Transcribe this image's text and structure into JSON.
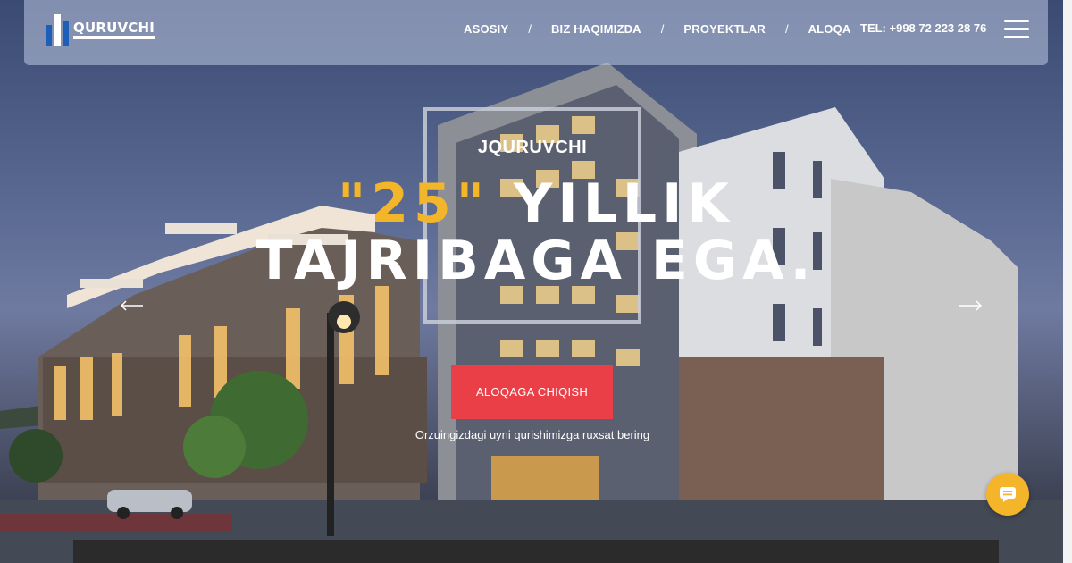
{
  "brand": {
    "name": "QURUVCHI"
  },
  "nav": {
    "items": [
      {
        "label": "ASOSIY"
      },
      {
        "label": "BIZ HAQIMIZDA"
      },
      {
        "label": "PROYEKTLAR"
      },
      {
        "label": "ALOQA"
      }
    ],
    "separator": "/"
  },
  "contact": {
    "phone": "TEL: +998 72 223 28 76"
  },
  "hero": {
    "subtitle": "JQURUVCHI",
    "headline_accent": "\"25\"",
    "headline_line1_rest": " YILLIK",
    "headline_line2": "TAJRIBAGA EGA.",
    "cta_label": "ALOQAGA CHIQISH",
    "tagline": "Orzuingizdagi uyni qurishimizga ruxsat bering"
  },
  "icons": {
    "menu": "hamburger-icon",
    "prev": "arrow-left-icon",
    "next": "arrow-right-icon",
    "chat": "chat-icon",
    "logo": "building-logo-icon"
  },
  "colors": {
    "accent": "#f3b52a",
    "cta": "#ea3f47",
    "chat": "#f5b52b",
    "logo_blue": "#1d5fb8"
  }
}
